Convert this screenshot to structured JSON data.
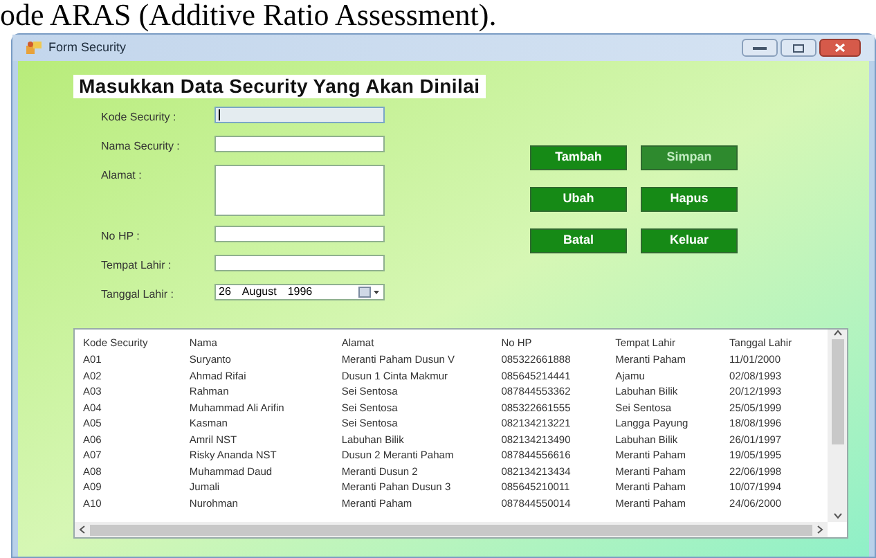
{
  "document_text": "ode ARAS (Additive Ratio Assessment).",
  "window": {
    "title": "Form Security"
  },
  "heading": "Masukkan Data Security Yang Akan Dinilai",
  "fields": [
    {
      "label": "Kode Security :",
      "kind": "text",
      "focused": true
    },
    {
      "label": "Nama Security :",
      "kind": "text",
      "focused": false
    },
    {
      "label": "Alamat :",
      "kind": "multiline",
      "focused": false
    },
    {
      "label": "No HP :",
      "kind": "text",
      "focused": false
    },
    {
      "label": "Tempat Lahir :",
      "kind": "text",
      "focused": false
    },
    {
      "label": "Tanggal Lahir :",
      "kind": "date",
      "focused": false,
      "day": "26",
      "month": "August",
      "year": "1996"
    }
  ],
  "buttons": [
    {
      "label": "Tambah",
      "disabled": false
    },
    {
      "label": "Simpan",
      "disabled": true
    },
    {
      "label": "Ubah",
      "disabled": false
    },
    {
      "label": "Hapus",
      "disabled": false
    },
    {
      "label": "Batal",
      "disabled": false
    },
    {
      "label": "Keluar",
      "disabled": false
    }
  ],
  "table": {
    "columns": [
      "Kode Security",
      "Nama",
      "Alamat",
      "No HP",
      "Tempat Lahir",
      "Tanggal Lahir"
    ],
    "rows": [
      [
        "A01",
        "Suryanto",
        "Meranti Paham Dusun V",
        "085322661888",
        "Meranti Paham",
        "11/01/2000"
      ],
      [
        "A02",
        "Ahmad Rifai",
        "Dusun 1 Cinta Makmur",
        "085645214441",
        "Ajamu",
        "02/08/1993"
      ],
      [
        "A03",
        "Rahman",
        "Sei Sentosa",
        "087844553362",
        "Labuhan Bilik",
        "20/12/1993"
      ],
      [
        "A04",
        "Muhammad Ali Arifin",
        "Sei Sentosa",
        "085322661555",
        "Sei Sentosa",
        "25/05/1999"
      ],
      [
        "A05",
        "Kasman",
        "Sei Sentosa",
        "082134213221",
        "Langga Payung",
        "18/08/1996"
      ],
      [
        "A06",
        "Amril NST",
        "Labuhan Bilik",
        "082134213490",
        "Labuhan Bilik",
        "26/01/1997"
      ],
      [
        "A07",
        "Risky Ananda NST",
        "Dusun 2 Meranti Paham",
        "087844556616",
        "Meranti Paham",
        "19/05/1995"
      ],
      [
        "A08",
        "Muhammad Daud",
        "Meranti Dusun 2",
        "082134213434",
        "Meranti Paham",
        "22/06/1998"
      ],
      [
        "A09",
        "Jumali",
        "Meranti Pahan Dusun 3",
        "085645210011",
        "Meranti Paham",
        "10/07/1994"
      ],
      [
        "A10",
        "Nurohman",
        "Meranti Paham",
        "087844550014",
        "Meranti Paham",
        "24/06/2000"
      ]
    ]
  }
}
